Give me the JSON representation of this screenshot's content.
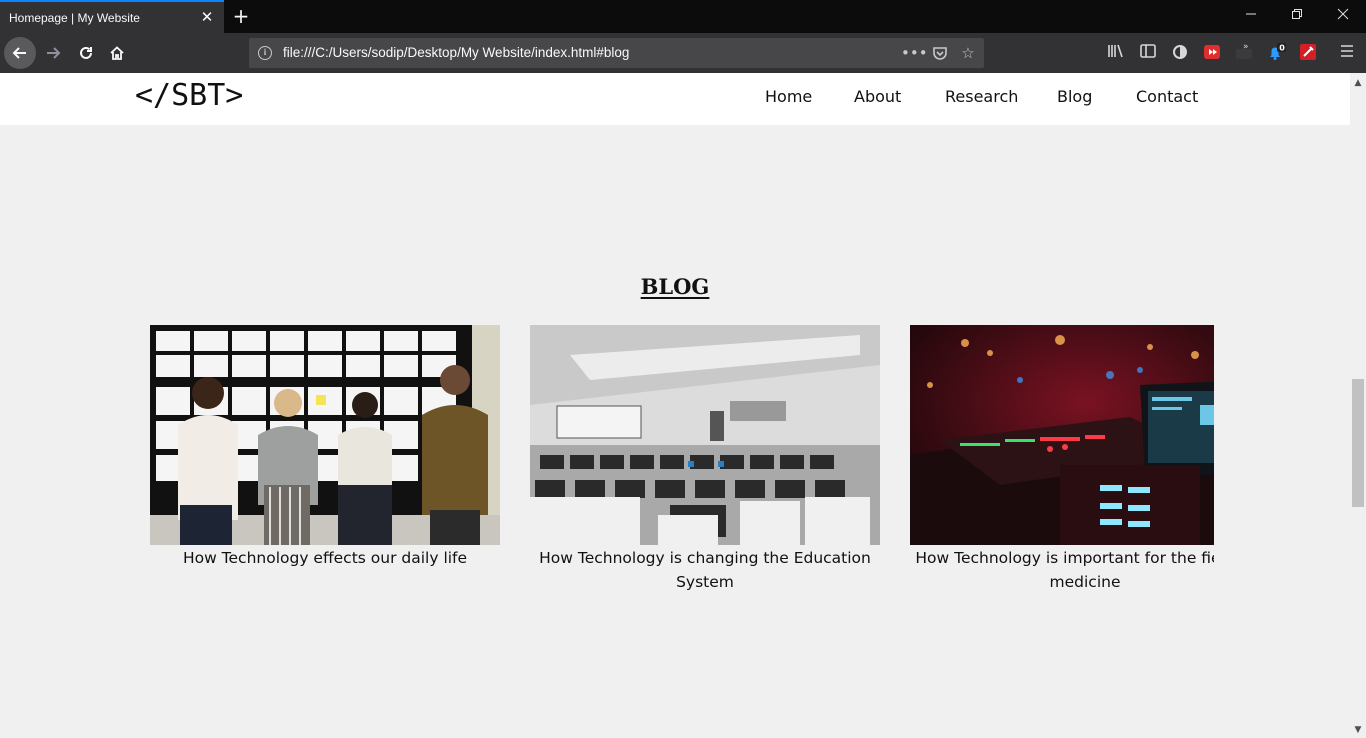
{
  "browser": {
    "tab_title": "Homepage | My Website",
    "url": "file:///C:/Users/sodip/Desktop/My Website/index.html#blog",
    "notification_count": "0"
  },
  "site": {
    "logo": "</SBT>",
    "nav": [
      "Home",
      "About",
      "Research",
      "Blog",
      "Contact"
    ]
  },
  "blog": {
    "heading": "BLOG",
    "posts": [
      {
        "caption": "How Technology effects our daily life"
      },
      {
        "caption": "How Technology is changing the Education System"
      },
      {
        "caption": "How Technology is important for the field of medicine"
      }
    ]
  }
}
